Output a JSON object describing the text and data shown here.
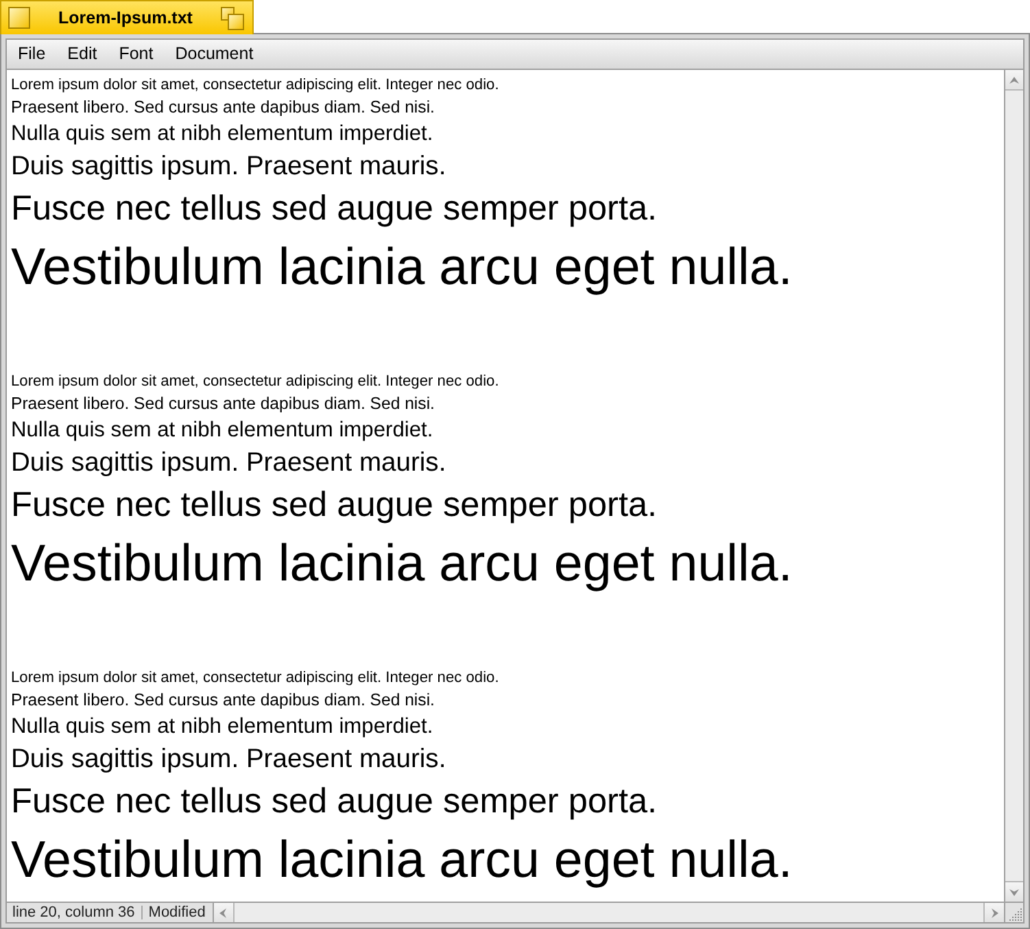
{
  "window": {
    "title": "Lorem-Ipsum.txt"
  },
  "menu_bar": {
    "items": [
      "File",
      "Edit",
      "Font",
      "Document"
    ]
  },
  "document": {
    "blocks": [
      {
        "lines": [
          "Lorem ipsum dolor sit amet, consectetur adipiscing elit. Integer nec odio.",
          "Praesent libero. Sed cursus ante dapibus diam. Sed nisi.",
          "Nulla quis sem at nibh elementum imperdiet.",
          "Duis sagittis ipsum. Praesent mauris.",
          "Fusce nec tellus sed augue semper porta.",
          "Vestibulum lacinia arcu eget nulla."
        ]
      },
      {
        "lines": [
          "Lorem ipsum dolor sit amet, consectetur adipiscing elit. Integer nec odio.",
          "Praesent libero. Sed cursus ante dapibus diam. Sed nisi.",
          "Nulla quis sem at nibh elementum imperdiet.",
          "Duis sagittis ipsum. Praesent mauris.",
          "Fusce nec tellus sed augue semper porta.",
          "Vestibulum lacinia arcu eget nulla."
        ]
      },
      {
        "lines": [
          "Lorem ipsum dolor sit amet, consectetur adipiscing elit. Integer nec odio.",
          "Praesent libero. Sed cursus ante dapibus diam. Sed nisi.",
          "Nulla quis sem at nibh elementum imperdiet.",
          "Duis sagittis ipsum. Praesent mauris.",
          "Fusce nec tellus sed augue semper porta.",
          "Vestibulum lacinia arcu eget nulla."
        ]
      }
    ]
  },
  "status_bar": {
    "position": "line 20, column 36",
    "state": "Modified"
  }
}
